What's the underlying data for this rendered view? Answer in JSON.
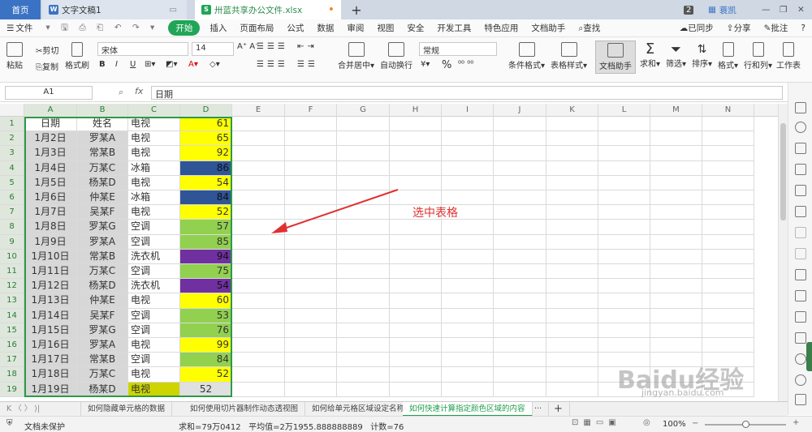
{
  "titlebar": {
    "home_tab": "首页",
    "doc_tab": "文字文稿1",
    "xls_tab": "卅蓝共享办公文件.xlsx",
    "new_tab": "+",
    "badge": "2",
    "user": "蓑凯"
  },
  "menubar": {
    "file": "文件",
    "items": [
      "开始",
      "插入",
      "页面布局",
      "公式",
      "数据",
      "审阅",
      "视图",
      "安全",
      "开发工具",
      "特色应用",
      "文档助手"
    ],
    "search": "查找",
    "sync": "已同步",
    "share": "分享",
    "comment": "批注",
    "help": "?"
  },
  "ribbon": {
    "paste": "粘贴",
    "cut": "剪切",
    "copy": "复制",
    "format_painter": "格式刷",
    "font_name": "宋体",
    "font_size": "14",
    "bold": "B",
    "italic": "I",
    "underline": "U",
    "merge": "合并居中",
    "wrap": "自动换行",
    "number_format": "常规",
    "percent": "%",
    "cond_format": "条件格式",
    "table_style": "表格样式",
    "doc_assist": "文档助手",
    "sum": "求和",
    "filter": "筛选",
    "sort": "排序",
    "format": "格式",
    "rowcol": "行和列",
    "worksheet": "工作表"
  },
  "formula": {
    "cell_ref": "A1",
    "fx": "fx",
    "value": "日期"
  },
  "columns": [
    "A",
    "B",
    "C",
    "D",
    "E",
    "F",
    "G",
    "H",
    "I",
    "J",
    "K",
    "L",
    "M",
    "N"
  ],
  "rows": [
    {
      "num": "1",
      "a": "日期",
      "b": "姓名",
      "c": "电视",
      "d": "61",
      "color": "#ffff00"
    },
    {
      "num": "2",
      "a": "1月2日",
      "b": "罗某A",
      "c": "电视",
      "d": "65",
      "color": "#ffff00"
    },
    {
      "num": "3",
      "a": "1月3日",
      "b": "常某B",
      "c": "电视",
      "d": "92",
      "color": "#ffff00"
    },
    {
      "num": "4",
      "a": "1月4日",
      "b": "万某C",
      "c": "冰箱",
      "d": "86",
      "color": "#2f5597"
    },
    {
      "num": "5",
      "a": "1月5日",
      "b": "杨某D",
      "c": "电视",
      "d": "54",
      "color": "#ffff00"
    },
    {
      "num": "6",
      "a": "1月6日",
      "b": "仲某E",
      "c": "冰箱",
      "d": "84",
      "color": "#2f5597"
    },
    {
      "num": "7",
      "a": "1月7日",
      "b": "吴某F",
      "c": "电视",
      "d": "52",
      "color": "#ffff00"
    },
    {
      "num": "8",
      "a": "1月8日",
      "b": "罗某G",
      "c": "空调",
      "d": "57",
      "color": "#92d050"
    },
    {
      "num": "9",
      "a": "1月9日",
      "b": "罗某A",
      "c": "空调",
      "d": "85",
      "color": "#92d050"
    },
    {
      "num": "10",
      "a": "1月10日",
      "b": "常某B",
      "c": "洗衣机",
      "d": "94",
      "color": "#7030a0"
    },
    {
      "num": "11",
      "a": "1月11日",
      "b": "万某C",
      "c": "空调",
      "d": "75",
      "color": "#92d050"
    },
    {
      "num": "12",
      "a": "1月12日",
      "b": "杨某D",
      "c": "洗衣机",
      "d": "54",
      "color": "#7030a0"
    },
    {
      "num": "13",
      "a": "1月13日",
      "b": "仲某E",
      "c": "电视",
      "d": "60",
      "color": "#ffff00"
    },
    {
      "num": "14",
      "a": "1月14日",
      "b": "吴某F",
      "c": "空调",
      "d": "53",
      "color": "#92d050"
    },
    {
      "num": "15",
      "a": "1月15日",
      "b": "罗某G",
      "c": "空调",
      "d": "76",
      "color": "#92d050"
    },
    {
      "num": "16",
      "a": "1月16日",
      "b": "罗某A",
      "c": "电视",
      "d": "99",
      "color": "#ffff00"
    },
    {
      "num": "17",
      "a": "1月17日",
      "b": "常某B",
      "c": "空调",
      "d": "84",
      "color": "#92d050"
    },
    {
      "num": "18",
      "a": "1月18日",
      "b": "万某C",
      "c": "电视",
      "d": "52",
      "color": "#ffff00"
    },
    {
      "num": "19",
      "a": "1月19日",
      "b": "杨某D",
      "c": "电视",
      "d": "52",
      "color": "#e0e0e0"
    }
  ],
  "annotation": "选中表格",
  "sheets": [
    "如何隐藏单元格的数据",
    "如何使用切片器制作动态透视图",
    "如何给单元格区域设定名称",
    "如何快速计算指定颜色区域的内容"
  ],
  "sheet_more": "···",
  "sheet_add": "+",
  "status": {
    "protect": "文档未保护",
    "stats": "求和=79万0412   平均值=2万1955.888888889   计数=76",
    "zoom": "100%"
  },
  "watermark": "Baidu经验",
  "watermark_url": "jingyan.baidu.com"
}
